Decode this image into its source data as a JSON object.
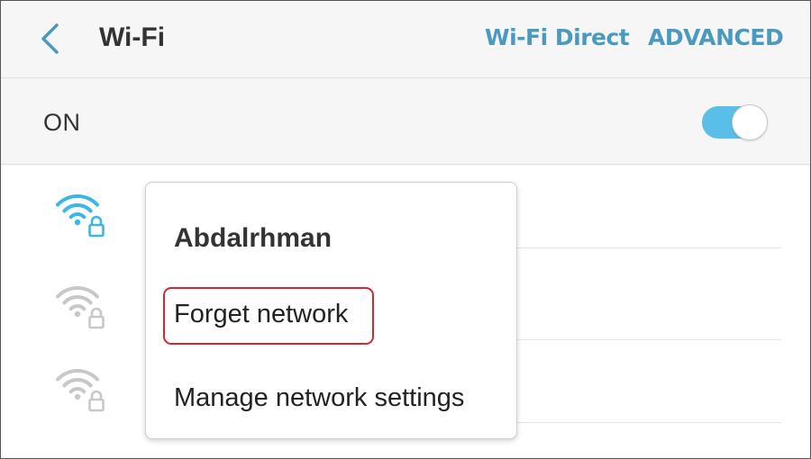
{
  "header": {
    "back_icon": "chevron-left-icon",
    "title": "Wi-Fi",
    "actions": [
      "Wi-Fi Direct",
      "ADVANCED"
    ]
  },
  "toggle": {
    "label": "ON",
    "state": "on"
  },
  "networks": [
    {
      "icon": "wifi-lock-icon",
      "signal": "strong",
      "connected": true
    },
    {
      "icon": "wifi-lock-icon",
      "signal": "weak",
      "connected": false
    },
    {
      "icon": "wifi-lock-icon",
      "signal": "weak",
      "connected": false
    }
  ],
  "context_menu": {
    "title": "Abdalrhman",
    "items": [
      "Forget network",
      "Manage network settings"
    ],
    "highlighted_item": "Forget network"
  },
  "colors": {
    "accent": "#4a9ac0",
    "toggle_track": "#59bfe8",
    "wifi_active": "#3cb6e6",
    "wifi_inactive": "#c8c8c8",
    "highlight_border": "#d8262f",
    "text_primary": "#333333"
  }
}
